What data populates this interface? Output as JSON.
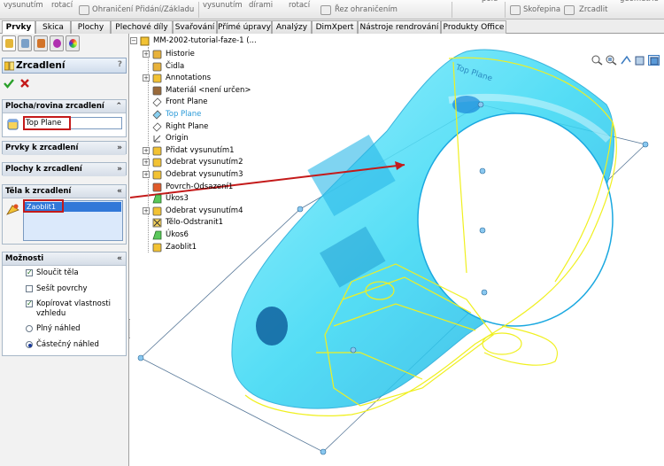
{
  "ribbon": {
    "items": [
      "vysunutím",
      "rotací",
      "Ohraničení Přidání/Základu",
      "vysunutím",
      "dírami",
      "rotací",
      "Řez ohraničením",
      "Skořepina",
      "Zrcadlit",
      "geometrie",
      "pole"
    ]
  },
  "tabs": [
    "Prvky",
    "Skica",
    "Plochy",
    "Plechové díly",
    "Svařování",
    "Přímé úpravy",
    "Analýzy",
    "DimXpert",
    "Nástroje rendrování",
    "Produkty Office"
  ],
  "property_manager": {
    "title": "Zrcadlení",
    "help": "?",
    "ok_icon": "check-icon",
    "cancel_icon": "close-icon",
    "sections": {
      "mirror_plane": {
        "title": "Plocha/rovina zrcadlení",
        "value": "Top Plane"
      },
      "features": {
        "title": "Prvky k zrcadlení"
      },
      "faces": {
        "title": "Plochy k zrcadlení"
      },
      "bodies": {
        "title": "Těla k zrcadlení",
        "selected": "Zaoblit1"
      },
      "options": {
        "title": "Možnosti",
        "items": [
          {
            "label": "Sloučit těla",
            "checked": true
          },
          {
            "label": "Sešít povrchy",
            "checked": false
          },
          {
            "label": "Kopírovat vlastnosti vzhledu",
            "checked": true
          }
        ],
        "radios": [
          {
            "label": "Plný náhled",
            "selected": false
          },
          {
            "label": "Částečný náhled",
            "selected": true
          }
        ]
      }
    }
  },
  "tree": {
    "root": "MM-2002-tutorial-faze-1  (...",
    "items": [
      {
        "label": "Historie",
        "icon": "folder-icon",
        "expandable": true
      },
      {
        "label": "Čidla",
        "icon": "sensor-icon",
        "expandable": false
      },
      {
        "label": "Annotations",
        "icon": "annotation-icon",
        "expandable": true
      },
      {
        "label": "Materiál <není určen>",
        "icon": "material-icon",
        "expandable": false
      },
      {
        "label": "Front Plane",
        "icon": "plane-icon",
        "expandable": false
      },
      {
        "label": "Top Plane",
        "icon": "plane-icon",
        "expandable": false,
        "highlight": true
      },
      {
        "label": "Right Plane",
        "icon": "plane-icon",
        "expandable": false
      },
      {
        "label": "Origin",
        "icon": "origin-icon",
        "expandable": false
      },
      {
        "label": "Přidat vysunutím1",
        "icon": "extrude-icon",
        "expandable": true
      },
      {
        "label": "Odebrat vysunutím2",
        "icon": "cut-icon",
        "expandable": true
      },
      {
        "label": "Odebrat vysunutím3",
        "icon": "cut-icon",
        "expandable": true
      },
      {
        "label": "Povrch-Odsazení1",
        "icon": "surface-icon",
        "expandable": false
      },
      {
        "label": "Úkos3",
        "icon": "draft-icon",
        "expandable": false
      },
      {
        "label": "Odebrat vysunutím4",
        "icon": "cut-icon",
        "expandable": true
      },
      {
        "label": "Tělo-Odstranit1",
        "icon": "delete-body-icon",
        "expandable": false
      },
      {
        "label": "Úkos6",
        "icon": "draft-icon",
        "expandable": false
      },
      {
        "label": "Zaoblit1",
        "icon": "fillet-icon",
        "expandable": false
      }
    ]
  },
  "model_label": "Top Plane",
  "colors": {
    "accent_red": "#c41a1a",
    "model_cyan": "#38d8f4",
    "preview_yellow": "#f0f020",
    "highlight_blue": "#3278d8"
  }
}
